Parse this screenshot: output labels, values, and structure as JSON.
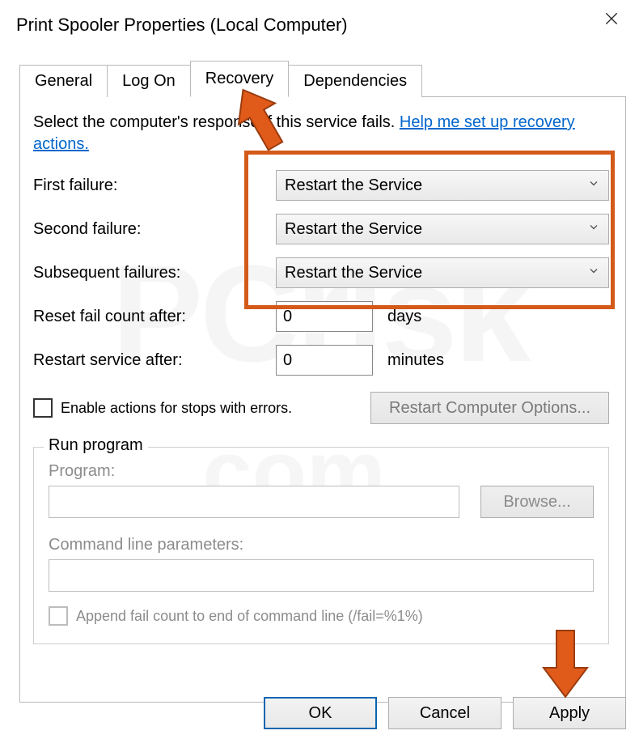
{
  "title": "Print Spooler Properties (Local Computer)",
  "tabs": {
    "general": "General",
    "logon": "Log On",
    "recovery": "Recovery",
    "dependencies": "Dependencies"
  },
  "intro_pre": "Select the computer's response if this service fails. ",
  "intro_link": "Help me set up recovery actions.",
  "rows": {
    "first": {
      "label": "First failure:",
      "value": "Restart the Service"
    },
    "second": {
      "label": "Second failure:",
      "value": "Restart the Service"
    },
    "subsequent": {
      "label": "Subsequent failures:",
      "value": "Restart the Service"
    },
    "reset": {
      "label": "Reset fail count after:",
      "value": "0",
      "unit": "days"
    },
    "restart": {
      "label": "Restart service after:",
      "value": "0",
      "unit": "minutes"
    }
  },
  "enable_actions_label": "Enable actions for stops with errors.",
  "restart_computer_btn": "Restart Computer Options...",
  "group": {
    "legend": "Run program",
    "program_label": "Program:",
    "browse": "Browse...",
    "cmdline_label": "Command line parameters:",
    "append_label": "Append fail count to end of command line (/fail=%1%)"
  },
  "buttons": {
    "ok": "OK",
    "cancel": "Cancel",
    "apply": "Apply"
  }
}
